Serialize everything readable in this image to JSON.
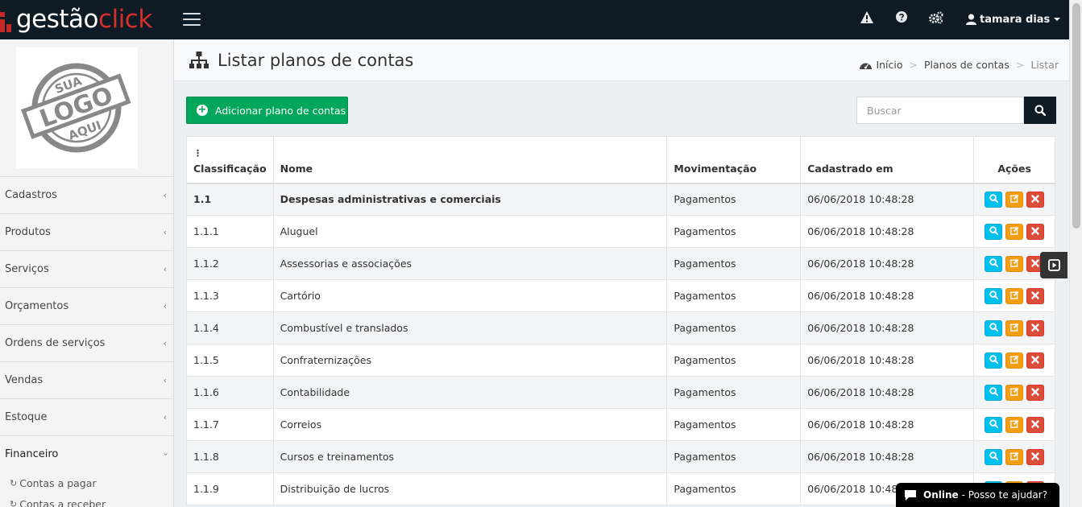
{
  "brand": {
    "part1": "gestão",
    "part2": "click"
  },
  "topbar": {
    "icons": [
      "warning-icon",
      "help-icon",
      "gears-icon"
    ],
    "user_name": "tamara dias"
  },
  "sidebar": {
    "logo": {
      "top": "SUA",
      "middle": "LOGO",
      "bottom": "AQUI"
    },
    "items": [
      {
        "label": "Cadastros"
      },
      {
        "label": "Produtos"
      },
      {
        "label": "Serviços"
      },
      {
        "label": "Orçamentos"
      },
      {
        "label": "Ordens de serviços"
      },
      {
        "label": "Vendas"
      },
      {
        "label": "Estoque"
      },
      {
        "label": "Financeiro"
      }
    ],
    "subitems": [
      {
        "label": "Contas a pagar"
      },
      {
        "label": "Contas a receber"
      }
    ]
  },
  "header": {
    "title": "Listar planos de contas",
    "breadcrumb": {
      "home": "Início",
      "section": "Planos de contas",
      "current": "Listar"
    }
  },
  "toolbar": {
    "add_label": "Adicionar plano de contas",
    "search_placeholder": "Buscar"
  },
  "table": {
    "sort_icon": "⋮",
    "headers": {
      "classificacao": "Classificação",
      "nome": "Nome",
      "movimentacao": "Movimentação",
      "cadastrado": "Cadastrado em",
      "acoes": "Ações"
    },
    "rows": [
      {
        "classificacao": "1.1",
        "nome": "Despesas administrativas e comerciais",
        "movimentacao": "Pagamentos",
        "cadastrado": "06/06/2018 10:48:28"
      },
      {
        "classificacao": "1.1.1",
        "nome": "Aluguel",
        "movimentacao": "Pagamentos",
        "cadastrado": "06/06/2018 10:48:28"
      },
      {
        "classificacao": "1.1.2",
        "nome": "Assessorias e associações",
        "movimentacao": "Pagamentos",
        "cadastrado": "06/06/2018 10:48:28"
      },
      {
        "classificacao": "1.1.3",
        "nome": "Cartório",
        "movimentacao": "Pagamentos",
        "cadastrado": "06/06/2018 10:48:28"
      },
      {
        "classificacao": "1.1.4",
        "nome": "Combustível e translados",
        "movimentacao": "Pagamentos",
        "cadastrado": "06/06/2018 10:48:28"
      },
      {
        "classificacao": "1.1.5",
        "nome": "Confraternizações",
        "movimentacao": "Pagamentos",
        "cadastrado": "06/06/2018 10:48:28"
      },
      {
        "classificacao": "1.1.6",
        "nome": "Contabilidade",
        "movimentacao": "Pagamentos",
        "cadastrado": "06/06/2018 10:48:28"
      },
      {
        "classificacao": "1.1.7",
        "nome": "Correios",
        "movimentacao": "Pagamentos",
        "cadastrado": "06/06/2018 10:48:28"
      },
      {
        "classificacao": "1.1.8",
        "nome": "Cursos e treinamentos",
        "movimentacao": "Pagamentos",
        "cadastrado": "06/06/2018 10:48:28"
      },
      {
        "classificacao": "1.1.9",
        "nome": "Distribuição de lucros",
        "movimentacao": "Pagamentos",
        "cadastrado": "06/06/2018 10:48:28"
      }
    ]
  },
  "chat": {
    "status": "Online",
    "message": "- Posso te ajudar?"
  },
  "colors": {
    "topbar": "#0f1b24",
    "brand_red": "#d32f2f",
    "success": "#00a65a",
    "info": "#00c0ef",
    "warning": "#f39c12",
    "danger": "#dd4b39"
  }
}
